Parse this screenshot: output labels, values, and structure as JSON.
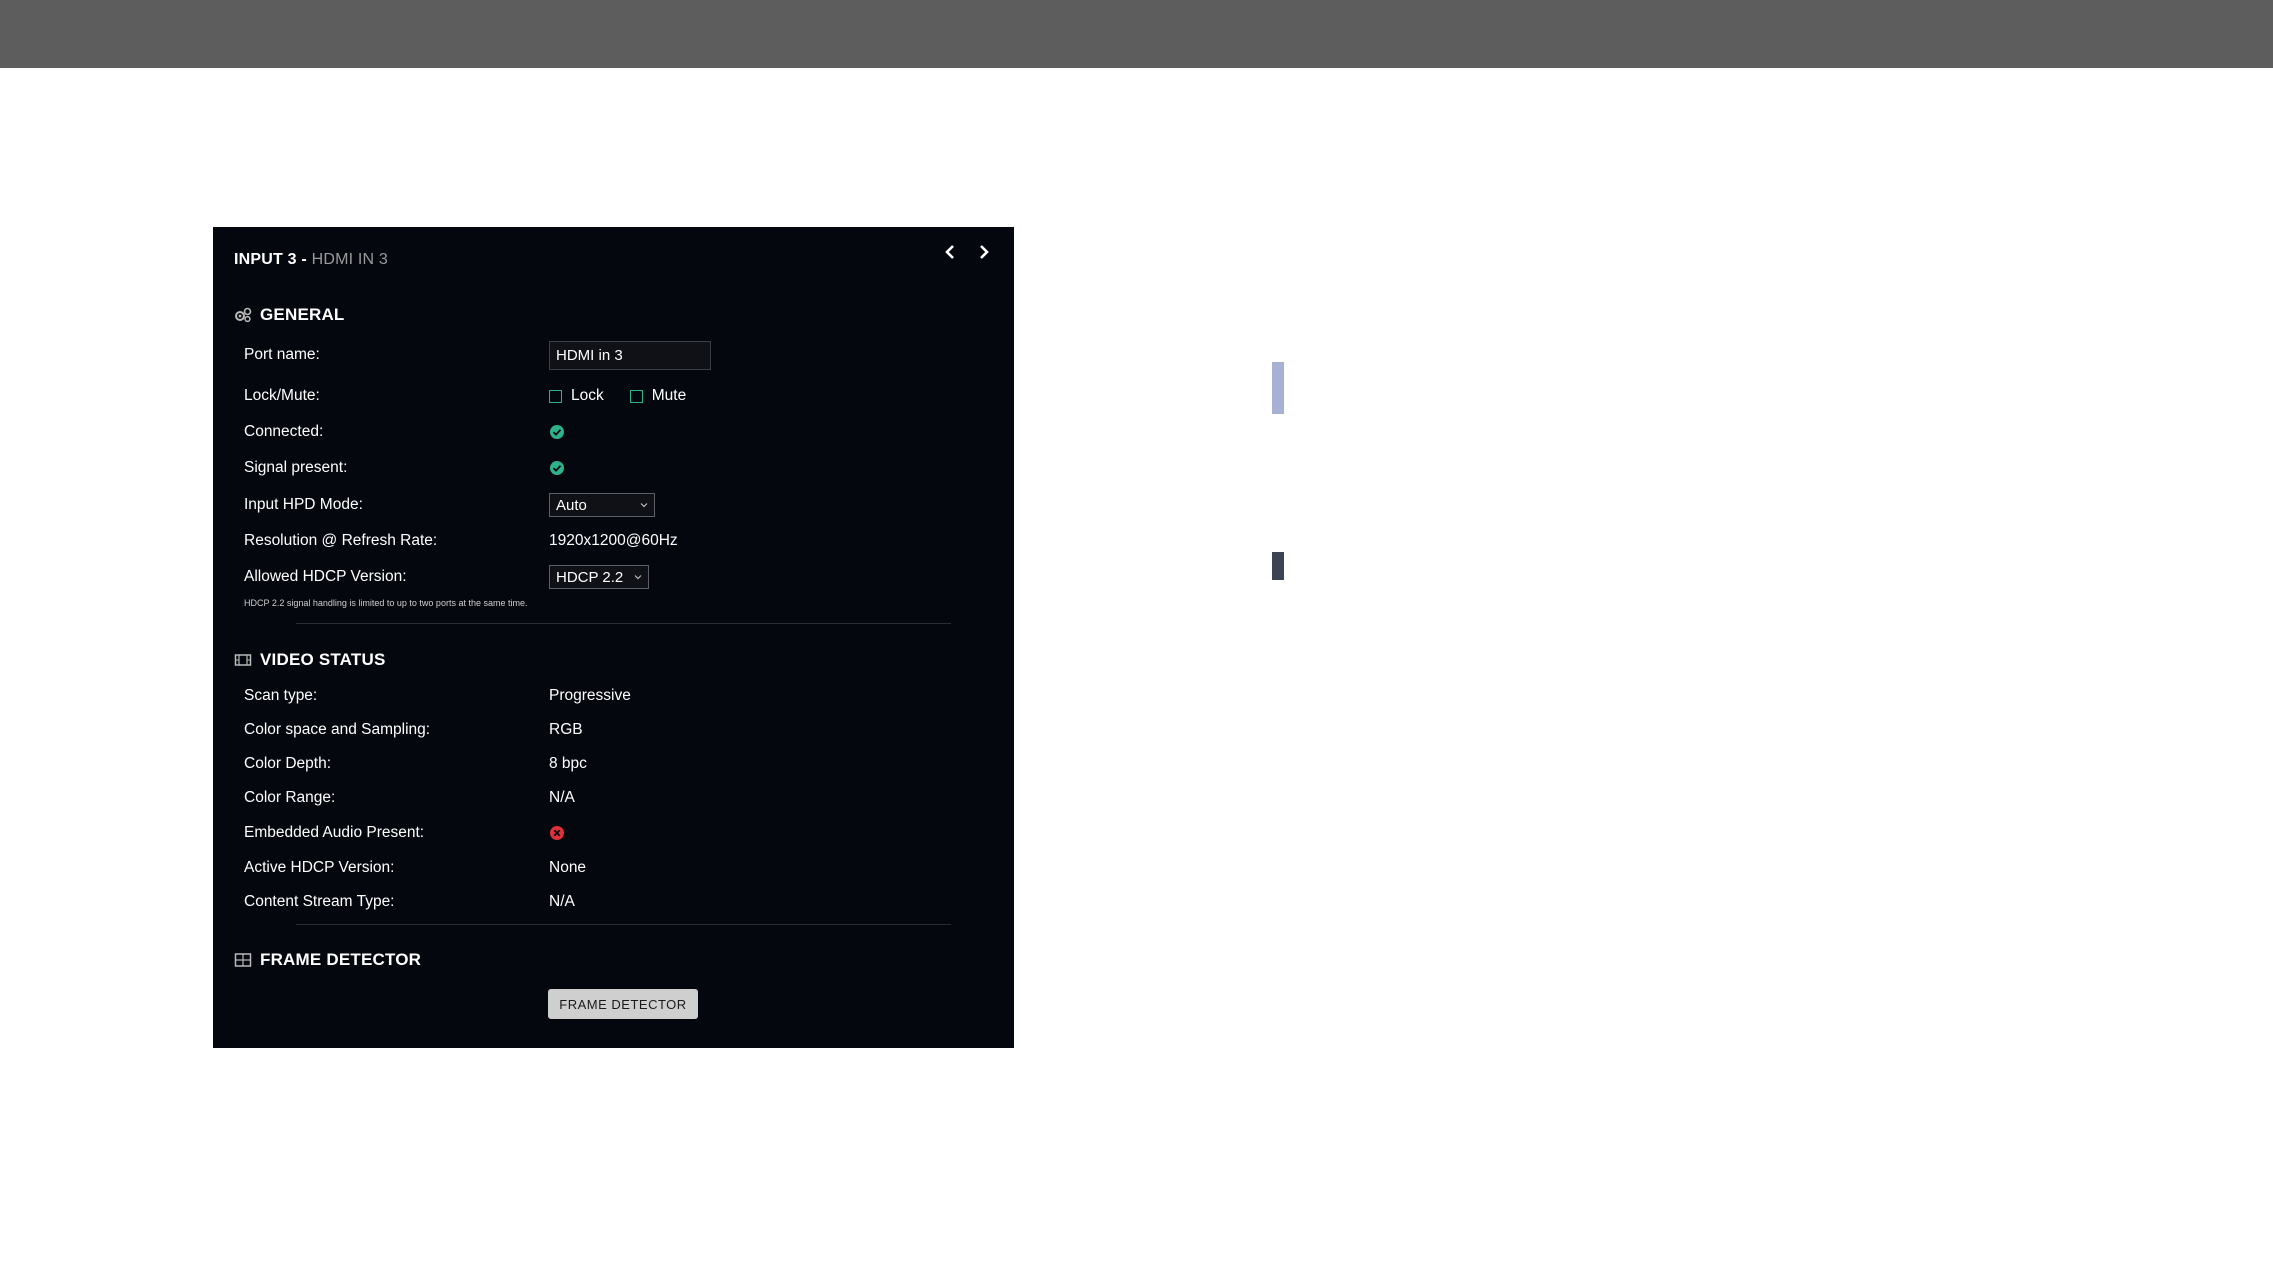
{
  "panel": {
    "title_main": "INPUT 3 - ",
    "title_sub": "HDMI IN 3"
  },
  "general": {
    "heading": "GENERAL",
    "icon": "gears-icon",
    "port_name_label": "Port name:",
    "port_name_value": "HDMI in 3",
    "lock_mute_label": "Lock/Mute:",
    "lock_label": "Lock",
    "mute_label": "Mute",
    "connected_label": "Connected:",
    "signal_label": "Signal present:",
    "hpd_label": "Input HPD Mode:",
    "hpd_value": "Auto",
    "resolution_label": "Resolution @ Refresh Rate:",
    "resolution_value": "1920x1200@60Hz",
    "hdcp_label": "Allowed HDCP Version:",
    "hdcp_value": "HDCP 2.2",
    "hdcp_note": "HDCP 2.2 signal handling is limited to up to two ports at the same time."
  },
  "video_status": {
    "heading": "VIDEO STATUS",
    "icon": "film-icon",
    "rows": [
      {
        "label": "Scan type:",
        "value": "Progressive"
      },
      {
        "label": "Color space and Sampling:",
        "value": "RGB"
      },
      {
        "label": "Color Depth:",
        "value": "8 bpc"
      },
      {
        "label": "Color Range:",
        "value": "N/A"
      },
      {
        "label": "Embedded Audio Present:",
        "value": ""
      },
      {
        "label": "Active HDCP Version:",
        "value": "None"
      },
      {
        "label": "Content Stream Type:",
        "value": "N/A"
      }
    ]
  },
  "frame_detector": {
    "heading": "FRAME DETECTOR",
    "icon": "grid-icon",
    "button_label": "FRAME DETECTOR"
  },
  "colors": {
    "topbar": "#5d5d5d",
    "panel_bg": "#05070f",
    "ok_green": "#2cb38a",
    "error_red": "#e0303a"
  }
}
